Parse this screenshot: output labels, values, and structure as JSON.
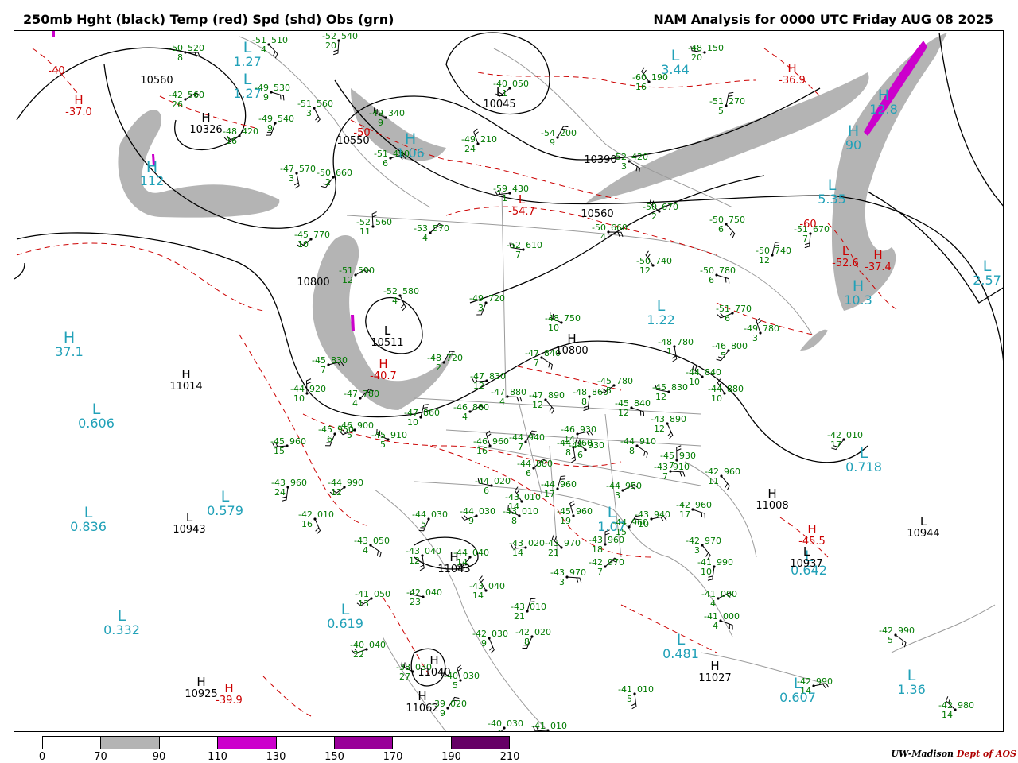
{
  "header": {
    "title_left": "250mb Hght (black) Temp (red) Spd (shd) Obs (grn)",
    "title_right": "NAM Analysis for 0000 UTC Friday  AUG 08 2025"
  },
  "legend": {
    "ticks": [
      "0",
      "70",
      "90",
      "110",
      "130",
      "150",
      "170",
      "190",
      "210"
    ],
    "colors": [
      "#ffffff",
      "#b4b4b4",
      "#ffffff",
      "#cc00cc",
      "#ffffff",
      "#990099",
      "#ffffff",
      "#660066"
    ]
  },
  "credit": {
    "org": "UW-Madison",
    "dept": "Dept of AOS"
  },
  "colors": {
    "height": "#000000",
    "temp": "#cc0000",
    "obs": "#007a00",
    "speed_label": "#21a1b8",
    "shade_70": "#b4b4b4"
  },
  "systems": [
    {
      "type": "L",
      "label": "1.27",
      "cls": "speed"
    },
    {
      "type": "L",
      "label": "3.44",
      "cls": "speed"
    },
    {
      "type": "H",
      "label": "-36.9",
      "cls": "temp"
    },
    {
      "type": "H",
      "label": "-37.0",
      "cls": "temp"
    },
    {
      "type": "H",
      "label": "10326",
      "cls": "height"
    },
    {
      "type": "L",
      "label": "1.27",
      "cls": "speed"
    },
    {
      "type": "L",
      "label": "10045",
      "cls": "height"
    },
    {
      "type": "L",
      "label": "5.35",
      "cls": "speed"
    },
    {
      "type": "L",
      "label": "2.57",
      "cls": "speed"
    },
    {
      "type": "H",
      "label": "37.1",
      "cls": "speed"
    },
    {
      "type": "H",
      "label": "11014",
      "cls": "height"
    },
    {
      "type": "L",
      "label": "0.606",
      "cls": "speed"
    },
    {
      "type": "L",
      "label": "0.579",
      "cls": "speed"
    },
    {
      "type": "L",
      "label": "0.836",
      "cls": "speed"
    },
    {
      "type": "L",
      "label": "10943",
      "cls": "height"
    },
    {
      "type": "L",
      "label": "1.22",
      "cls": "speed"
    },
    {
      "type": "H",
      "label": "10800",
      "cls": "height"
    },
    {
      "type": "L",
      "label": "10511",
      "cls": "height"
    },
    {
      "type": "H",
      "label": "-40.7",
      "cls": "temp"
    },
    {
      "type": "L",
      "label": "0.718",
      "cls": "speed"
    },
    {
      "type": "H",
      "label": "11008",
      "cls": "height"
    },
    {
      "type": "L",
      "label": "10944",
      "cls": "height"
    },
    {
      "type": "L",
      "label": "1.07",
      "cls": "speed"
    },
    {
      "type": "H",
      "label": "11043",
      "cls": "height"
    },
    {
      "type": "L",
      "label": "0.332",
      "cls": "speed"
    },
    {
      "type": "L",
      "label": "0.619",
      "cls": "speed"
    },
    {
      "type": "L",
      "label": "0.481",
      "cls": "speed"
    },
    {
      "type": "H",
      "label": "11027",
      "cls": "height"
    },
    {
      "type": "L",
      "label": "0.607",
      "cls": "speed"
    },
    {
      "type": "L",
      "label": "1.36",
      "cls": "speed"
    },
    {
      "type": "H",
      "label": "10925",
      "cls": "height"
    },
    {
      "type": "H",
      "label": "-39.9",
      "cls": "temp"
    },
    {
      "type": "H",
      "label": "11040",
      "cls": "height"
    },
    {
      "type": "H",
      "label": "11062",
      "cls": "height"
    },
    {
      "type": "L",
      "label": "0.642",
      "cls": "speed"
    },
    {
      "type": "L",
      "label": "10937",
      "cls": "height"
    },
    {
      "type": "H",
      "label": "-45.5",
      "cls": "temp"
    },
    {
      "type": "L",
      "label": "-54.7",
      "cls": "temp"
    },
    {
      "type": "L",
      "label": "-52.6",
      "cls": "temp"
    },
    {
      "type": "H",
      "label": "-37.4",
      "cls": "temp"
    },
    {
      "type": "H",
      "label": "10.3",
      "cls": "speed"
    },
    {
      "type": "H",
      "label": "12.8",
      "cls": "speed"
    },
    {
      "type": "H",
      "label": "90",
      "cls": "speed"
    },
    {
      "type": "H",
      "label": "112",
      "cls": "speed"
    },
    {
      "type": "H",
      "label": "1.06",
      "cls": "speed"
    }
  ],
  "contour_labels": [
    {
      "label": "10560",
      "cls": "height"
    },
    {
      "label": "10550",
      "cls": "height"
    },
    {
      "label": "10390",
      "cls": "height"
    },
    {
      "label": "10560",
      "cls": "height"
    },
    {
      "label": "10800",
      "cls": "height"
    },
    {
      "label": "-40",
      "cls": "temp"
    },
    {
      "label": "-50",
      "cls": "temp"
    },
    {
      "label": "-60",
      "cls": "temp"
    }
  ],
  "stations": [
    {
      "t": "-50",
      "h": "520",
      "s": "8"
    },
    {
      "t": "-51",
      "h": "510",
      "s": "4"
    },
    {
      "t": "-52",
      "h": "540",
      "s": "20"
    },
    {
      "t": "-40",
      "h": "050",
      "s": "1"
    },
    {
      "t": "-48",
      "h": "150",
      "s": "20"
    },
    {
      "t": "-60",
      "h": "190",
      "s": "16"
    },
    {
      "t": "-51",
      "h": "270",
      "s": "5"
    },
    {
      "t": "-42",
      "h": "560",
      "s": "26"
    },
    {
      "t": "-49",
      "h": "530",
      "s": "9"
    },
    {
      "t": "-51",
      "h": "560",
      "s": "3"
    },
    {
      "t": "-49",
      "h": "540",
      "s": "9"
    },
    {
      "t": "-48",
      "h": "420",
      "s": "16"
    },
    {
      "t": "-49",
      "h": "340",
      "s": "9"
    },
    {
      "t": "-49",
      "h": "210",
      "s": "24"
    },
    {
      "t": "-54",
      "h": "200",
      "s": "9"
    },
    {
      "t": "-51",
      "h": "490",
      "s": "6"
    },
    {
      "t": "-52",
      "h": "420",
      "s": "3"
    },
    {
      "t": "-47",
      "h": "570",
      "s": "3"
    },
    {
      "t": "-50",
      "h": "660",
      "s": "2"
    },
    {
      "t": "-59",
      "h": "430",
      "s": "1"
    },
    {
      "t": "-50",
      "h": "670",
      "s": "2"
    },
    {
      "t": "-52",
      "h": "560",
      "s": "11"
    },
    {
      "t": "-53",
      "h": "570",
      "s": "4"
    },
    {
      "t": "-50",
      "h": "660",
      "s": "4"
    },
    {
      "t": "-50",
      "h": "750",
      "s": "6"
    },
    {
      "t": "-51",
      "h": "670",
      "s": "7"
    },
    {
      "t": "-45",
      "h": "770",
      "s": "10"
    },
    {
      "t": "-52",
      "h": "610",
      "s": "7"
    },
    {
      "t": "-50",
      "h": "740",
      "s": "12"
    },
    {
      "t": "-50",
      "h": "740",
      "s": "12"
    },
    {
      "t": "-51",
      "h": "590",
      "s": "12"
    },
    {
      "t": "-50",
      "h": "780",
      "s": "6"
    },
    {
      "t": "-52",
      "h": "580",
      "s": "4"
    },
    {
      "t": "-49",
      "h": "720",
      "s": "3"
    },
    {
      "t": "-51",
      "h": "770",
      "s": "6"
    },
    {
      "t": "-48",
      "h": "750",
      "s": "10"
    },
    {
      "t": "-49",
      "h": "780",
      "s": "3"
    },
    {
      "t": "-48",
      "h": "720",
      "s": "2"
    },
    {
      "t": "-45",
      "h": "830",
      "s": "7"
    },
    {
      "t": "-47",
      "h": "840",
      "s": "7"
    },
    {
      "t": "-48",
      "h": "780",
      "s": "1"
    },
    {
      "t": "-46",
      "h": "800",
      "s": "5"
    },
    {
      "t": "-47",
      "h": "830",
      "s": "12"
    },
    {
      "t": "-44",
      "h": "840",
      "s": "10"
    },
    {
      "t": "-44",
      "h": "920",
      "s": "10"
    },
    {
      "t": "-47",
      "h": "780",
      "s": "4"
    },
    {
      "t": "-47",
      "h": "880",
      "s": "4"
    },
    {
      "t": "-47",
      "h": "890",
      "s": "12"
    },
    {
      "t": "-48",
      "h": "860",
      "s": "8"
    },
    {
      "t": "-45",
      "h": "780",
      "s": "5"
    },
    {
      "t": "-45",
      "h": "830",
      "s": "12"
    },
    {
      "t": "-44",
      "h": "880",
      "s": "10"
    },
    {
      "t": "-47",
      "h": "860",
      "s": "10"
    },
    {
      "t": "-46",
      "h": "880",
      "s": "4"
    },
    {
      "t": "-45",
      "h": "840",
      "s": "12"
    },
    {
      "t": "-43",
      "h": "890",
      "s": "12"
    },
    {
      "t": "-45",
      "h": "950",
      "s": "6"
    },
    {
      "t": "-46",
      "h": "900",
      "s": "5"
    },
    {
      "t": "-45",
      "h": "910",
      "s": "5"
    },
    {
      "t": "-46",
      "h": "960",
      "s": "16"
    },
    {
      "t": "-44",
      "h": "940",
      "s": "7"
    },
    {
      "t": "-46",
      "h": "930",
      "s": "14"
    },
    {
      "t": "-44",
      "h": "910",
      "s": "8"
    },
    {
      "t": "-44",
      "h": "960",
      "s": "8"
    },
    {
      "t": "-42",
      "h": "010",
      "s": "17"
    },
    {
      "t": "-45",
      "h": "960",
      "s": "15"
    },
    {
      "t": "-44",
      "h": "930",
      "s": "6"
    },
    {
      "t": "-45",
      "h": "930",
      "s": "7"
    },
    {
      "t": "-44",
      "h": "880",
      "s": "6"
    },
    {
      "t": "-43",
      "h": "910",
      "s": "7"
    },
    {
      "t": "-42",
      "h": "960",
      "s": "11"
    },
    {
      "t": "-43",
      "h": "960",
      "s": "24"
    },
    {
      "t": "-44",
      "h": "990",
      "s": "12"
    },
    {
      "t": "-44",
      "h": "020",
      "s": "6"
    },
    {
      "t": "-43",
      "h": "010",
      "s": "14"
    },
    {
      "t": "-44",
      "h": "960",
      "s": "17"
    },
    {
      "t": "-44",
      "h": "950",
      "s": "3"
    },
    {
      "t": "-42",
      "h": "960",
      "s": "17"
    },
    {
      "t": "-42",
      "h": "010",
      "s": "16"
    },
    {
      "t": "-44",
      "h": "030",
      "s": "5"
    },
    {
      "t": "-44",
      "h": "030",
      "s": "9"
    },
    {
      "t": "-43",
      "h": "010",
      "s": "8"
    },
    {
      "t": "-45",
      "h": "960",
      "s": "19"
    },
    {
      "t": "-44",
      "h": "960",
      "s": "15"
    },
    {
      "t": "-43",
      "h": "940",
      "s": "10"
    },
    {
      "t": "-43",
      "h": "050",
      "s": "4"
    },
    {
      "t": "-43",
      "h": "040",
      "s": "12"
    },
    {
      "t": "-44",
      "h": "040",
      "s": "14"
    },
    {
      "t": "-43",
      "h": "020",
      "s": "14"
    },
    {
      "t": "-43",
      "h": "970",
      "s": "21"
    },
    {
      "t": "-43",
      "h": "960",
      "s": "18"
    },
    {
      "t": "-42",
      "h": "970",
      "s": "7"
    },
    {
      "t": "-43",
      "h": "970",
      "s": "3"
    },
    {
      "t": "-42",
      "h": "970",
      "s": "3"
    },
    {
      "t": "-41",
      "h": "990",
      "s": "10"
    },
    {
      "t": "-41",
      "h": "050",
      "s": "13"
    },
    {
      "t": "-42",
      "h": "040",
      "s": "23"
    },
    {
      "t": "-43",
      "h": "040",
      "s": "14"
    },
    {
      "t": "-43",
      "h": "010",
      "s": "21"
    },
    {
      "t": "-41",
      "h": "000",
      "s": "4"
    },
    {
      "t": "-41",
      "h": "000",
      "s": "4"
    },
    {
      "t": "-42",
      "h": "030",
      "s": "9"
    },
    {
      "t": "-42",
      "h": "020",
      "s": "8"
    },
    {
      "t": "-40",
      "h": "040",
      "s": "22"
    },
    {
      "t": "-38",
      "h": "030",
      "s": "27"
    },
    {
      "t": "-40",
      "h": "030",
      "s": "5"
    },
    {
      "t": "-39",
      "h": "020",
      "s": "9"
    },
    {
      "t": "-42",
      "h": "990",
      "s": "14"
    },
    {
      "t": "-42",
      "h": "990",
      "s": "5"
    },
    {
      "t": "-41",
      "h": "010",
      "s": "5"
    },
    {
      "t": "-40",
      "h": "030",
      "s": "4"
    },
    {
      "t": "-41",
      "h": "010",
      "s": "4"
    },
    {
      "t": "-42",
      "h": "980",
      "s": "14"
    }
  ]
}
